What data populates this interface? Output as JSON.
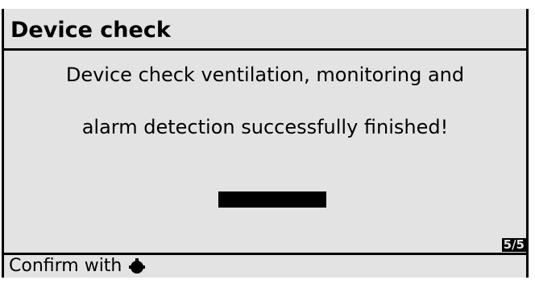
{
  "header": {
    "title": "Device check"
  },
  "main": {
    "message_line1": "Device check ventilation, monitoring and",
    "message_line2": "alarm detection successfully finished!",
    "progress": 1.0
  },
  "page_indicator": "5/5",
  "footer": {
    "confirm_label": "Confirm with",
    "confirm_icon": "rotary-knob-icon"
  }
}
